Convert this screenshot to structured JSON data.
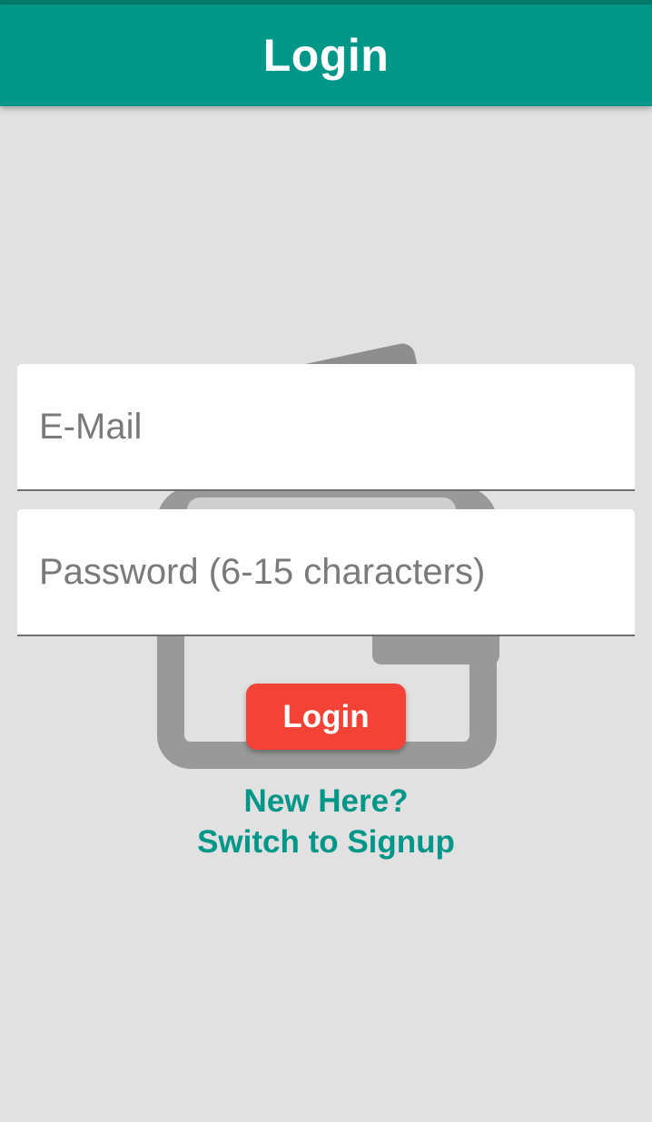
{
  "app_bar": {
    "title": "Login",
    "color": "#009688",
    "status_strip_color": "#00796b"
  },
  "form": {
    "email": {
      "placeholder": "E-Mail",
      "value": ""
    },
    "password": {
      "placeholder": "Password (6-15 characters)",
      "value": ""
    },
    "login_button": {
      "label": "Login",
      "color": "#f44336"
    },
    "switch_link": {
      "line1": "New Here?",
      "line2": "Switch to Signup",
      "color": "#009688"
    }
  },
  "background": {
    "color": "#e1e1e1",
    "illustration_icon": "cards-illustration-icon"
  }
}
